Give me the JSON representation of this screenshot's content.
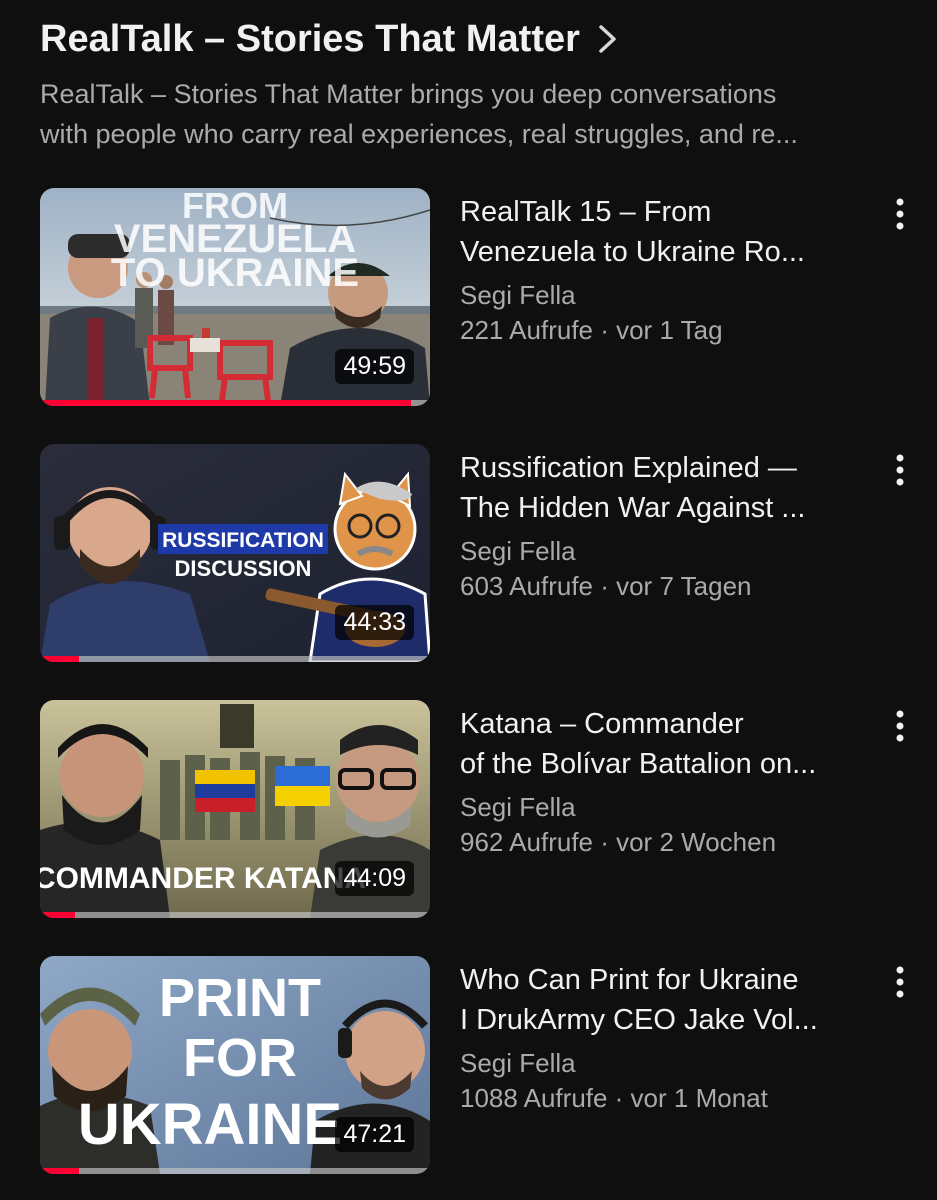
{
  "playlist": {
    "title": "RealTalk – Stories That Matter",
    "description_line1": "RealTalk – Stories That Matter brings you deep conversations",
    "description_line2": "with people who carry real experiences, real struggles, and re..."
  },
  "videos": [
    {
      "title_line1": "RealTalk 15 – From",
      "title_line2": "Venezuela to Ukraine  Ro...",
      "channel": "Segi Fella",
      "stats": "221 Aufrufe · vor 1 Tag",
      "duration": "49:59",
      "watched_fraction": 0.95,
      "thumb_text_1": "FROM",
      "thumb_text_2": "VENEZUELA",
      "thumb_text_3": "TO UKRAINE"
    },
    {
      "title_line1": "Russification Explained —",
      "title_line2": "The Hidden War Against ...",
      "channel": "Segi Fella",
      "stats": "603 Aufrufe · vor 7 Tagen",
      "duration": "44:33",
      "watched_fraction": 0.1,
      "thumb_text_1": "RUSSIFICATION",
      "thumb_text_2": "DISCUSSION"
    },
    {
      "title_line1": "Katana – Commander",
      "title_line2": "of the Bolívar Battalion on...",
      "channel": "Segi Fella",
      "stats": "962 Aufrufe · vor 2 Wochen",
      "duration": "44:09",
      "watched_fraction": 0.09,
      "thumb_text_1": "COMMANDER KATANA"
    },
    {
      "title_line1": "Who Can Print for Ukraine",
      "title_line2": "I DrukArmy CEO Jake Vol...",
      "channel": "Segi Fella",
      "stats": "1088 Aufrufe · vor 1 Monat",
      "duration": "47:21",
      "watched_fraction": 0.1,
      "thumb_text_1": "PRINT",
      "thumb_text_2": "FOR",
      "thumb_text_3": "UKRAINE"
    }
  ],
  "colors": {
    "background": "#0f0f0f",
    "primary_text": "#f1f1f1",
    "secondary_text": "#aaaaaa",
    "progress_red": "#ff0033"
  },
  "icons": {
    "chevron": "chevron-right-icon",
    "menu": "more-vert-icon"
  }
}
